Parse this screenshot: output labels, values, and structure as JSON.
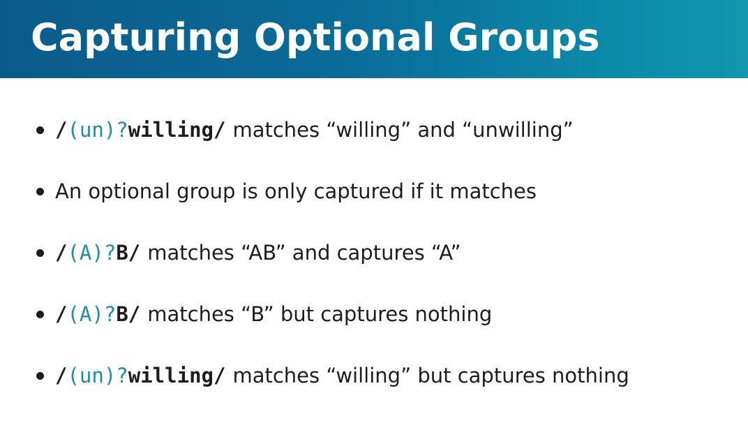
{
  "slide": {
    "title": "Capturing Optional Groups",
    "colors": {
      "header_start": "#0b5b8a",
      "header_end": "#1197ae",
      "code_group": "#1f8fa0",
      "text": "#1d1d1d"
    },
    "bullets": [
      {
        "code_open": "/",
        "code_group": "(un)?",
        "code_literal": "willing",
        "code_close": "/",
        "text": "matches “willing” and “unwilling”"
      },
      {
        "text": "An optional group is only captured if it matches"
      },
      {
        "code_open": "/",
        "code_group": "(A)?",
        "code_literal": "B",
        "code_close": "/",
        "text": "matches “AB” and captures “A”"
      },
      {
        "code_open": "/",
        "code_group": "(A)?",
        "code_literal": "B",
        "code_close": "/",
        "text": "matches “B” but captures nothing"
      },
      {
        "code_open": "/",
        "code_group": "(un)?",
        "code_literal": "willing",
        "code_close": "/",
        "text": "matches “willing” but captures nothing"
      }
    ]
  }
}
